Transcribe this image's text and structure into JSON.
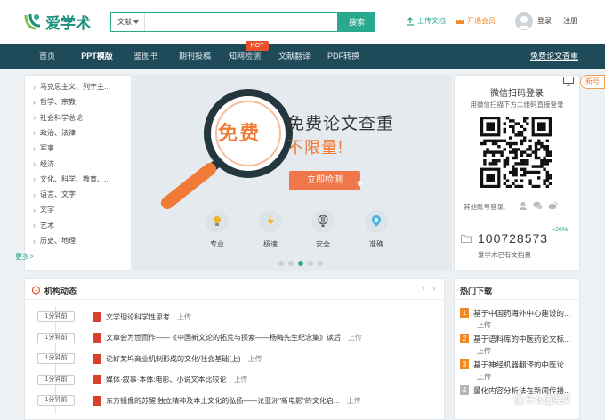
{
  "header": {
    "logo_text": "爱学术",
    "search_type": "文献",
    "search_placeholder": "",
    "search_button": "搜索",
    "upload_label": "上传文档",
    "vip_label": "开通会员",
    "login_label": "登录",
    "register_label": "注册"
  },
  "nav": {
    "items": [
      "首页",
      "PPT模版",
      "鉴图书",
      "期刊投稿",
      "知网检测",
      "文献翻译",
      "PDF转换"
    ],
    "active_index": 1,
    "hot_badge": "HOT",
    "right_link": "免费论文查重"
  },
  "categories": {
    "items": [
      "马克思主义、列宁主...",
      "哲学、宗教",
      "社会科学总论",
      "政治、法律",
      "军事",
      "经济",
      "文化、科学、教育、...",
      "语言、文字",
      "文学",
      "艺术",
      "历史、地理"
    ],
    "more": "更多>"
  },
  "banner": {
    "free_text": "免费",
    "headline": "免费论文查重",
    "subheadline": "不限量!",
    "cta": "立即检测",
    "features": [
      {
        "label": "专业",
        "icon": "bulb-icon"
      },
      {
        "label": "极速",
        "icon": "lightning-icon"
      },
      {
        "label": "安全",
        "icon": "balloon-icon"
      },
      {
        "label": "准确",
        "icon": "location-pin-icon"
      }
    ],
    "active_slide": 3,
    "slide_count": 5
  },
  "qr_login": {
    "title": "微信扫码登录",
    "subtitle": "用微信扫描下方二维码直接登录",
    "other_label": "其他账号登录:",
    "doc_count": "100728573",
    "growth": "+26%",
    "doc_caption": "爱学术已有文档量",
    "new_tag": "新号"
  },
  "institution": {
    "title": "机构动态",
    "rows": [
      {
        "time": "1分钟前",
        "title": "文学理论科学性思考",
        "action": "上传"
      },
      {
        "time": "1分钟前",
        "title": "文章会为世而作——《中国新文论的拓荒与探索——杨晦先生纪念集》读后",
        "action": "上传"
      },
      {
        "time": "1分钟前",
        "title": "论好莱坞商业机制形成的文化/社会基础(上)",
        "action": "上传"
      },
      {
        "time": "1分钟前",
        "title": "媒体·叙事·本体:电影、小说文本比较论",
        "action": "上传"
      },
      {
        "time": "1分钟前",
        "title": "东方镜像的苏醒:独立精神及本土文化的弘扬——论亚洲\"新电影\"的文化启...",
        "action": "上传"
      }
    ]
  },
  "hot_downloads": {
    "title": "热门下载",
    "items": [
      {
        "rank": "1",
        "title": "基于中国药海外中心建设的...",
        "action": "上传"
      },
      {
        "rank": "2",
        "title": "基于语料库的中医药论文标...",
        "action": "上传"
      },
      {
        "rank": "3",
        "title": "基于神经机器翻译的中医论...",
        "action": "上传"
      },
      {
        "rank": "4",
        "title": "量化内容分析法在新闻传播..."
      }
    ],
    "rank_colors": [
      "#f08a24",
      "#f08a24",
      "#f08a24",
      "#b5b5b5"
    ]
  },
  "watermark": "值 什么值得买",
  "colors": {
    "accent": "#2aa98f",
    "nav_bg": "#1f4a5a",
    "hot": "#e8512b",
    "cta": "#f0774a",
    "vip": "#f08a24"
  }
}
